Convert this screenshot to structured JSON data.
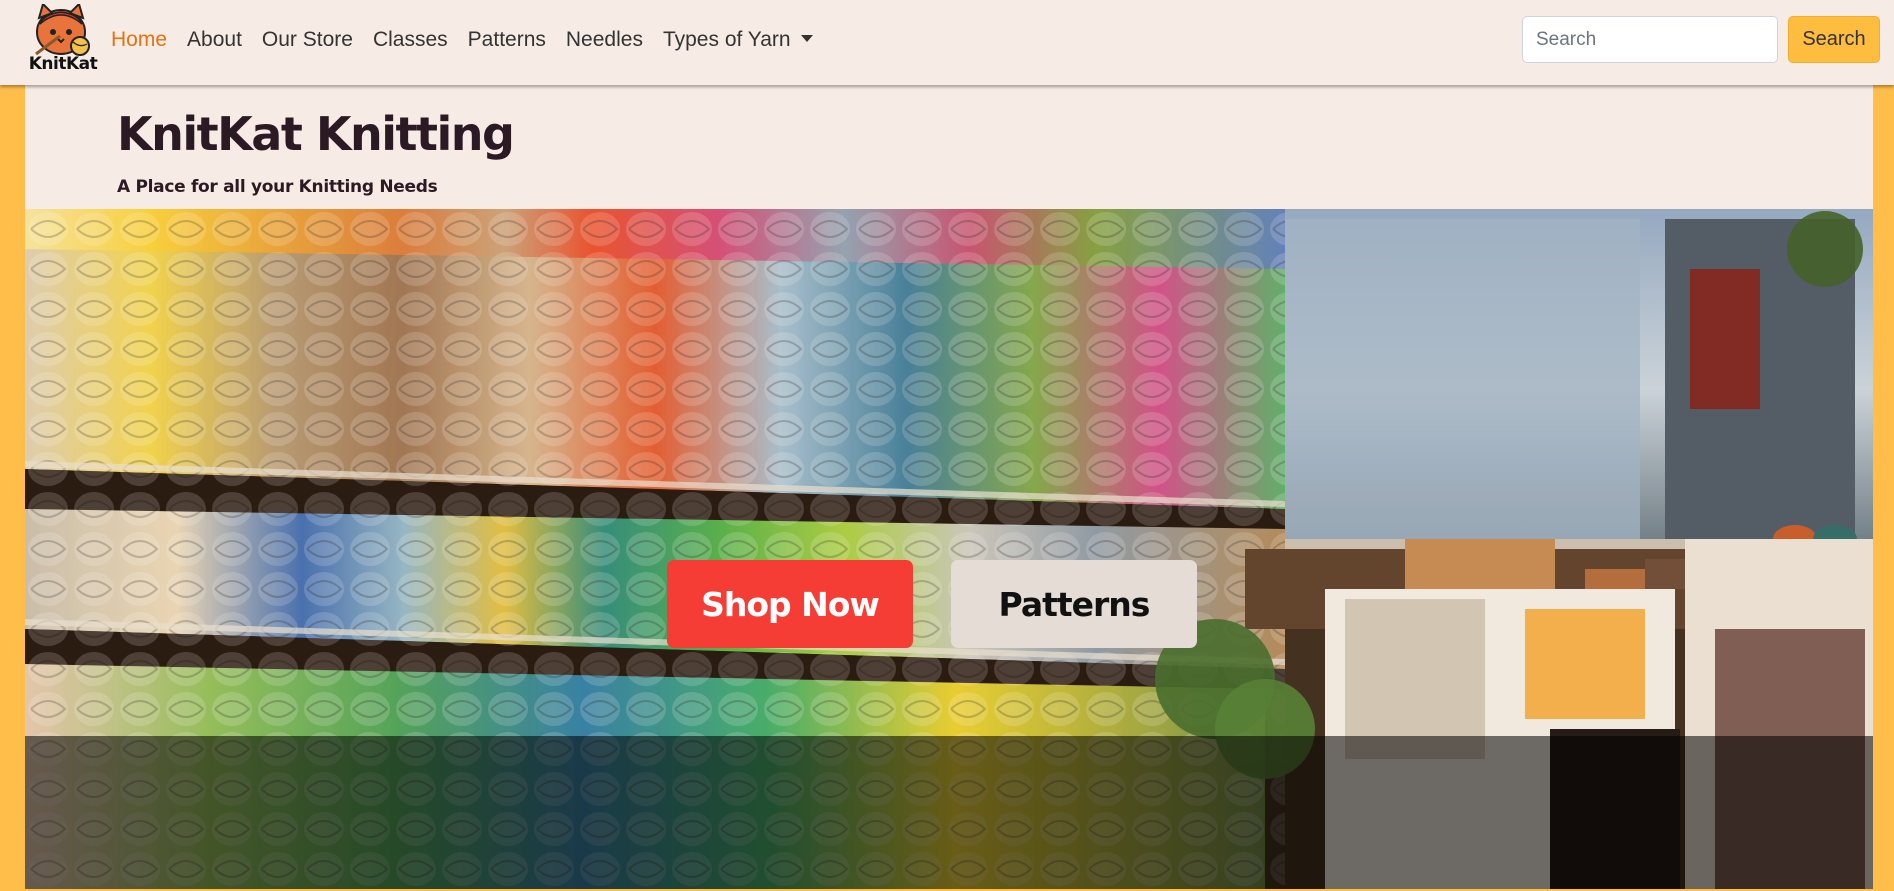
{
  "brand": {
    "name": "KnitKat",
    "logo_icon": "knitting-cat-icon"
  },
  "nav": {
    "items": [
      {
        "label": "Home",
        "active": true
      },
      {
        "label": "About"
      },
      {
        "label": "Our Store"
      },
      {
        "label": "Classes"
      },
      {
        "label": "Patterns"
      },
      {
        "label": "Needles"
      },
      {
        "label": "Types of Yarn",
        "dropdown": true
      }
    ]
  },
  "search": {
    "placeholder": "Search",
    "button_label": "Search"
  },
  "header": {
    "title": "KnitKat Knitting",
    "tagline": "A Place for all your Knitting Needs"
  },
  "hero": {
    "image_icon": "yarn-shop-photo",
    "buttons": {
      "shop_label": "Shop Now",
      "patterns_label": "Patterns"
    }
  },
  "colors": {
    "accent": "#e8710f",
    "frame": "#ffbd4a",
    "background": "#f7ece5",
    "shop_button": "#f53d35",
    "patterns_button": "#e4dcd5",
    "search_button": "#ffbd3f"
  }
}
